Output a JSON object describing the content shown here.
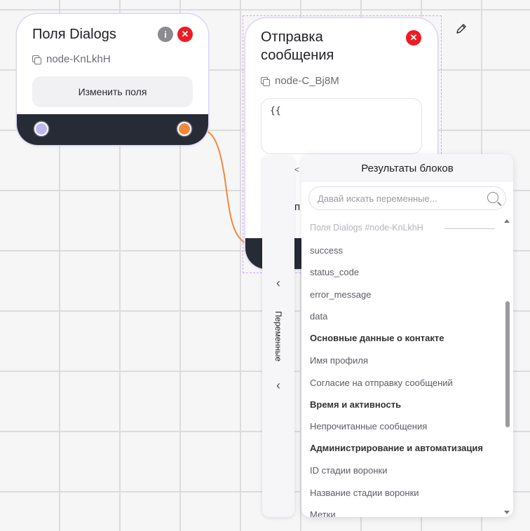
{
  "node1": {
    "title": "Поля Dialogs",
    "id": "node-KnLkhH",
    "button_label": "Изменить поля",
    "icons": [
      "info-icon",
      "close-icon"
    ]
  },
  "node2": {
    "title_line1": "Отправка",
    "title_line2": "сообщения",
    "id": "node-C_Bj8M",
    "text_value": "{{",
    "partial_fragment_1": "<",
    "partial_fragment_2": "п"
  },
  "toolbar": {
    "edit_icon": "pencil-icon"
  },
  "variables_tab": {
    "label": "Переменные"
  },
  "results_panel": {
    "title": "Результаты блоков",
    "search_placeholder": "Давай искать переменные...",
    "items": [
      {
        "label": "Поля Dialogs #node-KnLkhH",
        "kind": "section"
      },
      {
        "label": "success",
        "kind": "item"
      },
      {
        "label": "status_code",
        "kind": "item"
      },
      {
        "label": "error_message",
        "kind": "item"
      },
      {
        "label": "data",
        "kind": "item"
      },
      {
        "label": "Основные данные о контакте",
        "kind": "group"
      },
      {
        "label": "Имя профиля",
        "kind": "item"
      },
      {
        "label": "Согласие на отправку сообщений",
        "kind": "item"
      },
      {
        "label": "Время и активность",
        "kind": "group"
      },
      {
        "label": "Непрочитанные сообщения",
        "kind": "item"
      },
      {
        "label": "Администрирование и автоматизация",
        "kind": "group"
      },
      {
        "label": "ID стадии воронки",
        "kind": "item"
      },
      {
        "label": "Название стадии воронки",
        "kind": "item"
      },
      {
        "label": "Метки",
        "kind": "item"
      }
    ]
  },
  "colors": {
    "accent_orange": "#f5873b",
    "handle_lavender": "#bdb7ee",
    "footer_dark": "#272b35",
    "close_red": "#ee1b24",
    "selection_dash": "#d9a3f0"
  }
}
